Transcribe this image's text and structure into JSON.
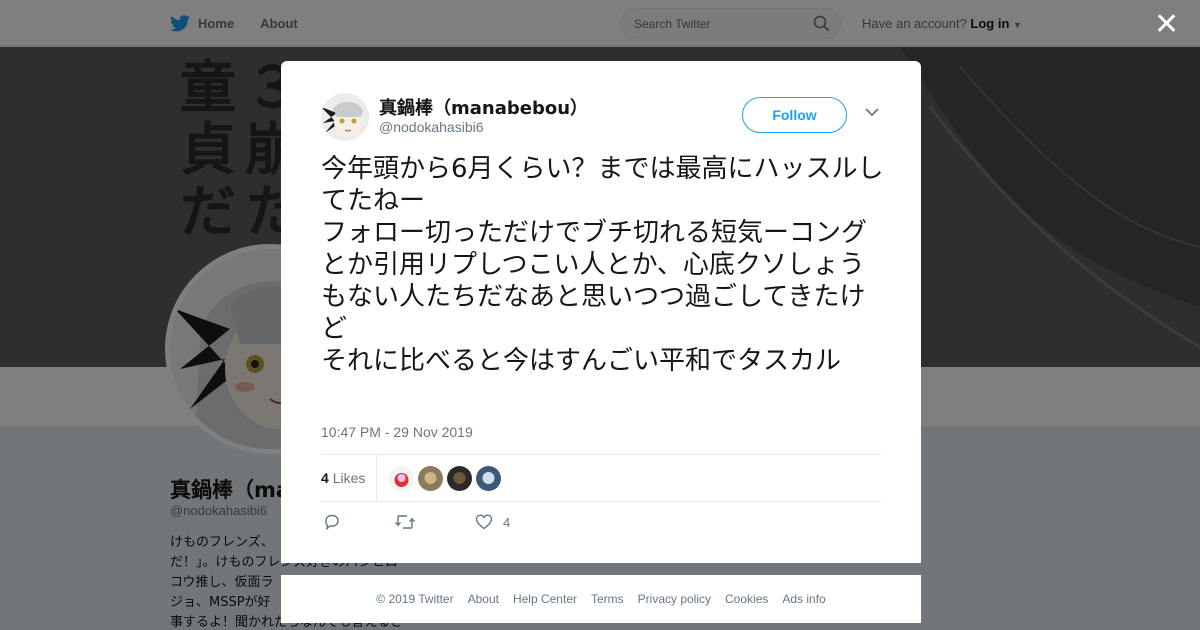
{
  "topbar": {
    "home_label": "Home",
    "about_label": "About",
    "search_placeholder": "Search Twitter",
    "have_account": "Have an account?",
    "login_label": "Log in"
  },
  "banner": {
    "column1": "童貞だ",
    "column2": "３崩た"
  },
  "profile": {
    "name": "真鍋棒（ma",
    "handle": "@nodokahasibi6",
    "bio_lines": [
      "けものフレンズ、",
      "だ！」。けものフレンズ好きのパンヒロ",
      "コウ推し、仮面ラ",
      "ジョ、MSSPが好",
      "事するよ！聞かれたらなんでも答えるさ"
    ]
  },
  "modal": {
    "name": "真鍋棒（manabebou）",
    "handle": "@nodokahasibi6",
    "follow_label": "Follow",
    "tweet_text": "今年頭から6月くらい？までは最高にハッスルしてたねー\nフォロー切っただけでブチ切れる短気ーコングとか引用リプしつこい人とか、心底クソしょうもない人たちだなあと思いつつ過ごしてきたけど\nそれに比べると今はすんごい平和でタスカル",
    "timestamp": "10:47 PM - 29 Nov 2019",
    "likes_count": "4",
    "likes_label": "Likes",
    "action_like_count": "4"
  },
  "footer": {
    "links": [
      "© 2019 Twitter",
      "About",
      "Help Center",
      "Terms",
      "Privacy policy",
      "Cookies",
      "Ads info"
    ]
  },
  "colors": {
    "twitter_blue": "#1da1f2",
    "text_primary": "#14171a",
    "text_secondary": "#657786"
  },
  "icons": {
    "close": "close-icon",
    "search": "search-icon",
    "bird": "twitter-bird-icon"
  }
}
